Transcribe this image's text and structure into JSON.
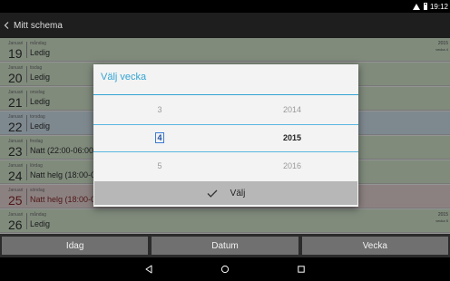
{
  "status_bar": {
    "time": "19:12",
    "icons": [
      "wifi-icon",
      "battery-icon"
    ]
  },
  "action_bar": {
    "title": "Mitt schema",
    "back_icon": "chevron-left-icon"
  },
  "schedule": {
    "days": [
      {
        "month": "Januari",
        "weekday": "måndag",
        "date": "19",
        "shift": "Ledig",
        "type": "free",
        "year": "2015",
        "week": "vecka 4"
      },
      {
        "month": "Januari",
        "weekday": "tisdag",
        "date": "20",
        "shift": "Ledig",
        "type": "free"
      },
      {
        "month": "Januari",
        "weekday": "onsdag",
        "date": "21",
        "shift": "Ledig",
        "type": "free"
      },
      {
        "month": "Januari",
        "weekday": "torsdag",
        "date": "22",
        "shift": "Ledig",
        "type": "work"
      },
      {
        "month": "Januari",
        "weekday": "fredag",
        "date": "23",
        "shift": "Natt (22:00-06:00)",
        "type": "free"
      },
      {
        "month": "Januari",
        "weekday": "lördag",
        "date": "24",
        "shift": "Natt helg (18:00-0",
        "type": "free"
      },
      {
        "month": "Januari",
        "weekday": "söndag",
        "date": "25",
        "shift": "Natt helg (18:00-0",
        "type": "weekend"
      },
      {
        "month": "Januari",
        "weekday": "måndag",
        "date": "26",
        "shift": "Ledig",
        "type": "free",
        "year": "2015",
        "week": "vecka 5"
      }
    ]
  },
  "bottom_buttons": {
    "today": "Idag",
    "date": "Datum",
    "week": "Vecka"
  },
  "dialog": {
    "title": "Välj vecka",
    "week_column": {
      "prev": "3",
      "selected": "4",
      "next": "5"
    },
    "year_column": {
      "prev": "2014",
      "selected": "2015",
      "next": "2016"
    },
    "confirm_label": "Välj",
    "confirm_icon": "checkmark-icon",
    "accent_color": "#33a4d3"
  },
  "nav_bar": {
    "icons": [
      "back-icon",
      "home-icon",
      "recents-icon"
    ]
  }
}
